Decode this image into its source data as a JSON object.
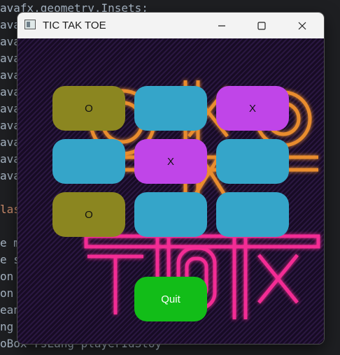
{
  "ide": {
    "lines": [
      {
        "text": "avafx.geometry.Insets;",
        "color": "#a9b7c6"
      },
      {
        "text": "ava",
        "color": "#a9b7c6"
      },
      {
        "text": "ava",
        "color": "#a9b7c6"
      },
      {
        "text": "ava",
        "color": "#a9b7c6"
      },
      {
        "text": "ava",
        "color": "#a9b7c6"
      },
      {
        "text": "ava",
        "color": "#a9b7c6"
      },
      {
        "text": "ava",
        "color": "#a9b7c6"
      },
      {
        "text": "ava",
        "color": "#a9b7c6"
      },
      {
        "text": "ava",
        "color": "#a9b7c6"
      },
      {
        "text": "ava",
        "color": "#a9b7c6"
      },
      {
        "text": "ava",
        "color": "#a9b7c6"
      },
      {
        "text": "",
        "color": "#a9b7c6"
      },
      {
        "text": "las",
        "color": "#cf8e6d"
      },
      {
        "text": "",
        "color": "#a9b7c6"
      },
      {
        "text": "e m",
        "color": "#a9b7c6"
      },
      {
        "text": "e s",
        "color": "#a9b7c6"
      },
      {
        "text": "on",
        "color": "#a9b7c6"
      },
      {
        "text": "on",
        "color": "#a9b7c6"
      },
      {
        "text": "ean",
        "color": "#a9b7c6"
      },
      {
        "text": "ng",
        "color": "#a9b7c6"
      },
      {
        "text": "oBox rsLang playerIdStoy",
        "color": "#a9b7c6"
      }
    ]
  },
  "window": {
    "title": "TIC TAK TOE",
    "icon": "app-window-icon",
    "controls": [
      "minimize-icon",
      "maximize-icon",
      "close-icon"
    ]
  },
  "board": {
    "cells": [
      {
        "label": "O",
        "color": "#8b8620"
      },
      {
        "label": "",
        "color": "#35a5c9"
      },
      {
        "label": "X",
        "color": "#c045e8"
      },
      {
        "label": "",
        "color": "#35a5c9"
      },
      {
        "label": "X",
        "color": "#c045e8"
      },
      {
        "label": "",
        "color": "#35a5c9"
      },
      {
        "label": "O",
        "color": "#8b8620"
      },
      {
        "label": "",
        "color": "#35a5c9"
      },
      {
        "label": "",
        "color": "#35a5c9"
      }
    ]
  },
  "quit": {
    "label": "Quit",
    "color": "#12bd18"
  },
  "colors": {
    "neon_orange": "#ff9a2e",
    "neon_pink": "#ff2f9a"
  }
}
